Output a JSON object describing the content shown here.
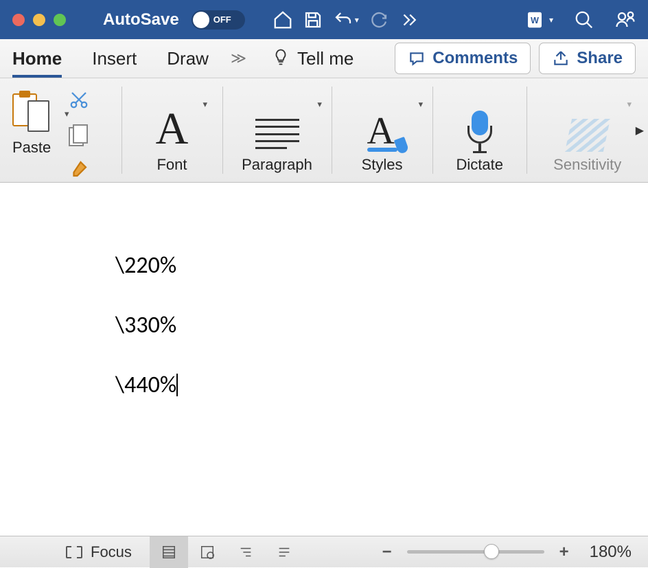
{
  "titlebar": {
    "autosave_label": "AutoSave",
    "autosave_state": "OFF"
  },
  "tabs": {
    "home": "Home",
    "insert": "Insert",
    "draw": "Draw",
    "tell_me": "Tell me"
  },
  "actions": {
    "comments": "Comments",
    "share": "Share"
  },
  "ribbon": {
    "paste": "Paste",
    "font": "Font",
    "paragraph": "Paragraph",
    "styles": "Styles",
    "dictate": "Dictate",
    "sensitivity": "Sensitivity"
  },
  "document": {
    "paragraphs": [
      "\\220%",
      "\\330%",
      "\\440%"
    ]
  },
  "statusbar": {
    "focus": "Focus",
    "zoom": "180%"
  }
}
